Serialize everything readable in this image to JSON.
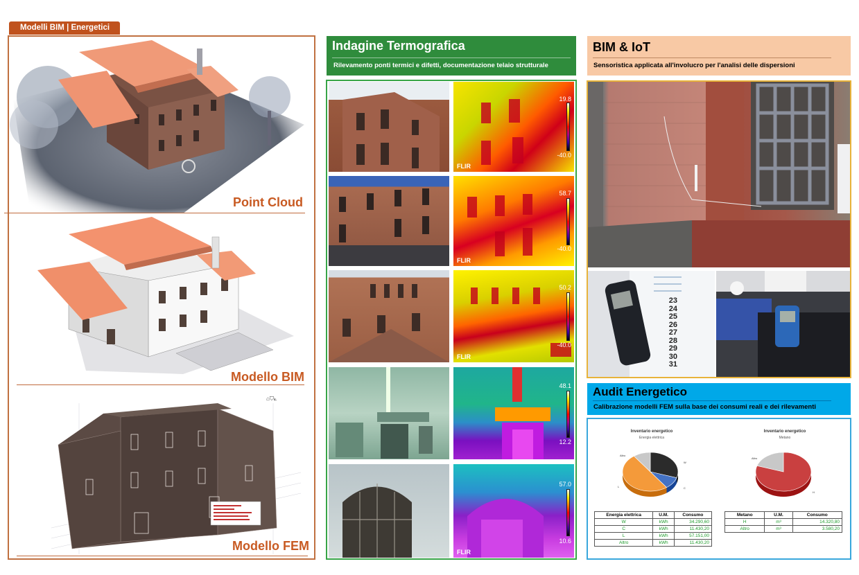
{
  "left": {
    "tab_label": "Modelli BIM | Energetici",
    "panels": [
      {
        "label": "Point Cloud"
      },
      {
        "label": "Modello BIM"
      },
      {
        "label": "Modello FEM"
      }
    ],
    "fem_toolbar_icons": [
      "home-icon",
      "shield-icon",
      "axis-icon"
    ]
  },
  "center": {
    "title": "Indagine Termografica",
    "subtitle": "Rilevamento ponti termici e difetti, documentazione telaio strutturale",
    "thermal_images": [
      {
        "max": "19.8",
        "min": "-40.0",
        "brand": "FLIR"
      },
      {
        "max": "58.7",
        "min": "-40.0",
        "brand": "FLIR"
      },
      {
        "max": "50.2",
        "min": "-40.0",
        "brand": "FLIR"
      },
      {
        "max": "48.1",
        "min": "12.2",
        "brand": "FLIR"
      },
      {
        "max": "57.0",
        "min": "10.6",
        "brand": "FLIR"
      }
    ]
  },
  "right": {
    "bim_iot": {
      "title": "BIM & IoT",
      "subtitle": "Sensoristica applicata all'involucro per l'analisi delle dispersioni"
    },
    "calendar_days": [
      "23",
      "24",
      "25",
      "26",
      "27",
      "28",
      "29",
      "30",
      "31"
    ],
    "audit": {
      "title": "Audit Energetico",
      "subtitle": "Calibrazione modelli FEM sulla base dei consumi reali e dei rilevamenti",
      "chart_data": [
        {
          "type": "pie",
          "title": "Inventario energetico",
          "subtitle": "Energia elettrica",
          "categories": [
            "W",
            "C",
            "L",
            "Altro"
          ],
          "values": [
            34290.6,
            11430.2,
            57151.0,
            11430.2
          ],
          "colors": [
            "#2b2b2b",
            "#4472c4",
            "#f49a3a",
            "#c8c8c8"
          ]
        },
        {
          "type": "pie",
          "title": "Inventario energetico",
          "subtitle": "Metano",
          "categories": [
            "H",
            "Altro"
          ],
          "values": [
            14320.8,
            3580.2
          ],
          "colors": [
            "#c94040",
            "#c8c8c8"
          ]
        }
      ],
      "table_electric": {
        "headers": [
          "Energia elettrica",
          "U.M.",
          "Consumo"
        ],
        "rows": [
          [
            "W",
            "kWh",
            "34.290,60"
          ],
          [
            "C",
            "kWh",
            "11.430,20"
          ],
          [
            "L",
            "kWh",
            "57.151,00"
          ],
          [
            "Altro",
            "kWh",
            "11.430,20"
          ]
        ]
      },
      "table_gas": {
        "headers": [
          "Metano",
          "U.M.",
          "Consumo"
        ],
        "rows": [
          [
            "H",
            "m³",
            "14.320,80"
          ],
          [
            "Altro",
            "m³",
            "3.580,20"
          ]
        ]
      }
    }
  }
}
